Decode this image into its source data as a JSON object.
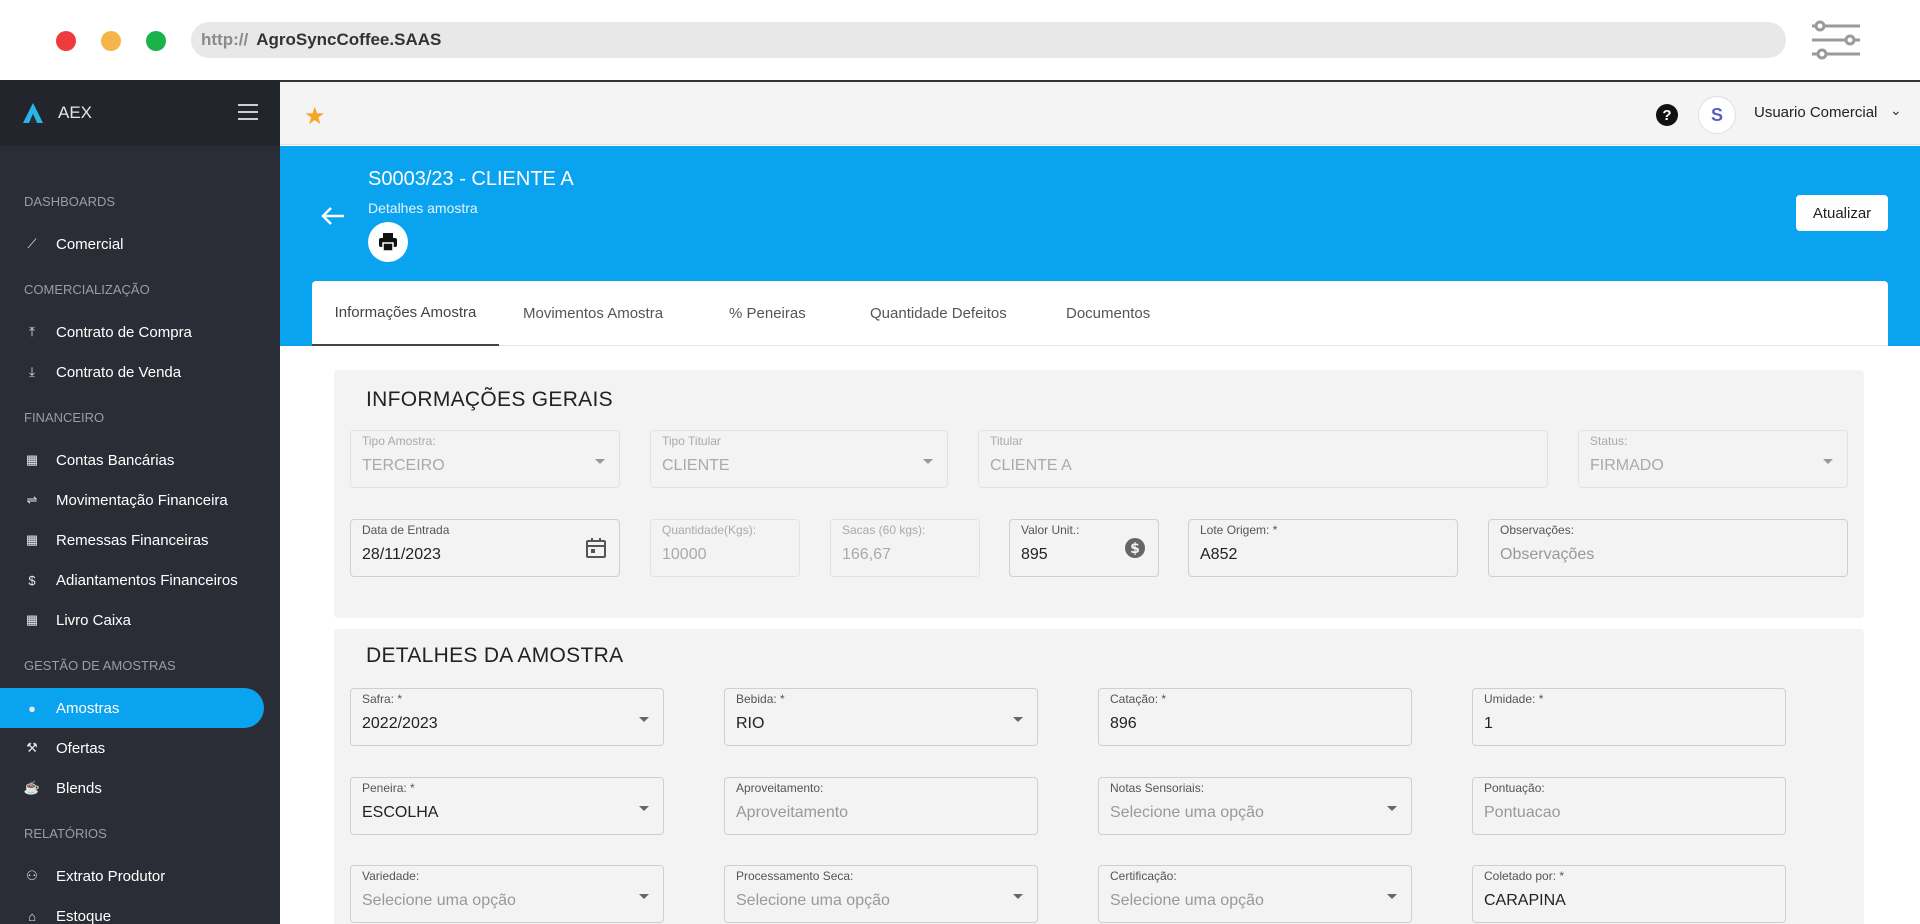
{
  "browser": {
    "url_protocol": "http://",
    "url_host": "AgroSyncCoffee.SAAS"
  },
  "sidebar": {
    "brand": "AEX",
    "sections": [
      {
        "title": "DASHBOARDS"
      },
      {
        "title": "COMERCIALIZAÇÃO"
      },
      {
        "title": "FINANCEIRO"
      },
      {
        "title": "GESTÃO DE AMOSTRAS"
      },
      {
        "title": "RELATÓRIOS"
      }
    ],
    "items": [
      {
        "label": "Comercial",
        "icon": "trend-icon"
      },
      {
        "label": "Contrato de Compra",
        "icon": "upload-icon"
      },
      {
        "label": "Contrato de Venda",
        "icon": "download-icon"
      },
      {
        "label": "Contas Bancárias",
        "icon": "calendar-icon"
      },
      {
        "label": "Movimentação Financeira",
        "icon": "transfer-icon"
      },
      {
        "label": "Remessas Financeiras",
        "icon": "calendar-icon"
      },
      {
        "label": "Adiantamentos Financeiros",
        "icon": "dollar-icon"
      },
      {
        "label": "Livro Caixa",
        "icon": "calendar-icon"
      },
      {
        "label": "Amostras",
        "icon": "info-icon",
        "active": true
      },
      {
        "label": "Ofertas",
        "icon": "gavel-icon"
      },
      {
        "label": "Blends",
        "icon": "coffee-icon"
      },
      {
        "label": "Extrato Produtor",
        "icon": "people-icon"
      },
      {
        "label": "Estoque",
        "icon": "warehouse-icon"
      }
    ]
  },
  "topbar": {
    "user_name": "Usuario Comercial",
    "help": "?",
    "avatar_letter": "S"
  },
  "header": {
    "title": "S0003/23 - CLIENTE A",
    "subtitle": "Detalhes amostra",
    "update_button": "Atualizar"
  },
  "tabs": [
    {
      "label": "Informações Amostra",
      "active": true
    },
    {
      "label": "Movimentos Amostra"
    },
    {
      "label": "% Peneiras"
    },
    {
      "label": "Quantidade Defeitos"
    },
    {
      "label": "Documentos"
    }
  ],
  "info_gerais": {
    "title": "INFORMAÇÕES GERAIS",
    "tipo_amostra": {
      "label": "Tipo Amostra:",
      "value": "TERCEIRO"
    },
    "tipo_titular": {
      "label": "Tipo Titular",
      "value": "CLIENTE"
    },
    "titular": {
      "label": "Titular",
      "value": "CLIENTE A"
    },
    "status": {
      "label": "Status:",
      "value": "FIRMADO"
    },
    "data_entrada": {
      "label": "Data de Entrada",
      "value": "28/11/2023"
    },
    "quantidade": {
      "label": "Quantidade(Kgs):",
      "value": "10000"
    },
    "sacas": {
      "label": "Sacas (60 kgs):",
      "value": "166,67"
    },
    "valor_unit": {
      "label": "Valor Unit.:",
      "value": "895"
    },
    "lote_origem": {
      "label": "Lote Origem: *",
      "value": "A852"
    },
    "observacoes": {
      "label": "Observações:",
      "placeholder": "Observações"
    }
  },
  "detalhes": {
    "title": "DETALHES DA AMOSTRA",
    "safra": {
      "label": "Safra: *",
      "value": "2022/2023"
    },
    "bebida": {
      "label": "Bebida: *",
      "value": "RIO"
    },
    "catacao": {
      "label": "Catação: *",
      "value": "896"
    },
    "umidade": {
      "label": "Umidade: *",
      "value": "1"
    },
    "peneira": {
      "label": "Peneira: *",
      "value": "ESCOLHA"
    },
    "aproveitamento": {
      "label": "Aproveitamento:",
      "placeholder": "Aproveitamento"
    },
    "notas_sensoriais": {
      "label": "Notas Sensoriais:",
      "placeholder": "Selecione uma opção"
    },
    "pontuacao": {
      "label": "Pontuação:",
      "placeholder": "Pontuacao"
    },
    "variedade": {
      "label": "Variedade:",
      "placeholder": "Selecione uma opção"
    },
    "processamento": {
      "label": "Processamento Seca:",
      "placeholder": "Selecione uma opção"
    },
    "certificacao": {
      "label": "Certificação:",
      "placeholder": "Selecione uma opção"
    },
    "coletado_por": {
      "label": "Coletado por: *",
      "value": "CARAPINA"
    }
  }
}
